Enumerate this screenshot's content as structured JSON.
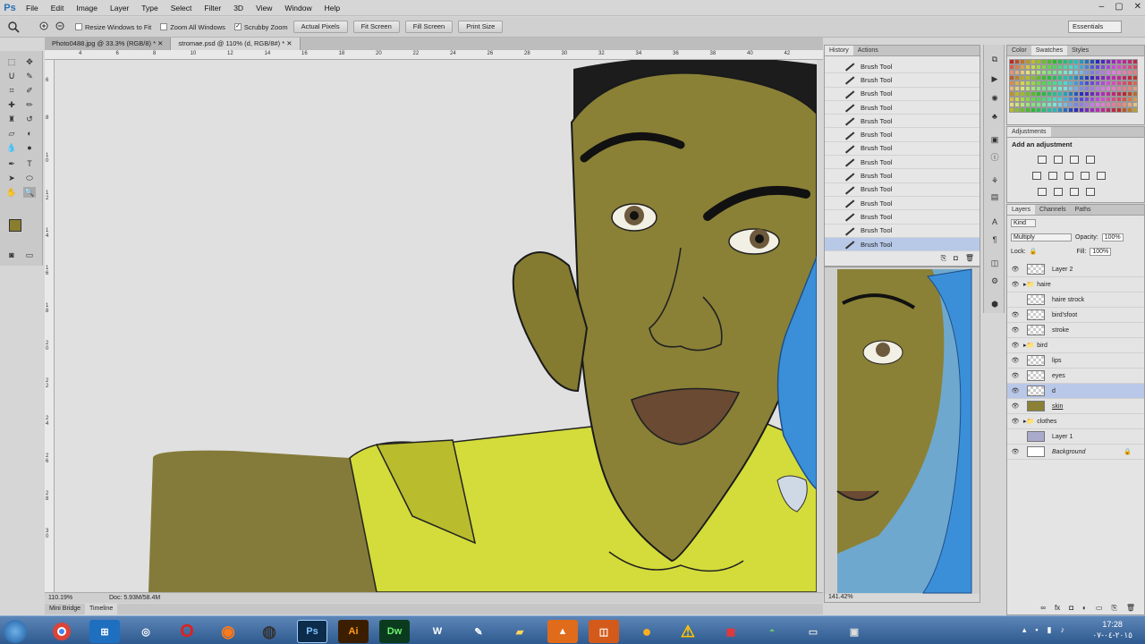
{
  "app": {
    "logo": "Ps",
    "menu": [
      "File",
      "Edit",
      "Image",
      "Layer",
      "Type",
      "Select",
      "Filter",
      "3D",
      "View",
      "Window",
      "Help"
    ],
    "window_controls": [
      "–",
      "▢",
      "✕"
    ]
  },
  "options_bar": {
    "tool_icon": "zoom-icon",
    "resize_windows_label": "Resize Windows to Fit",
    "zoom_all_label": "Zoom All Windows",
    "scrubby_zoom_label": "Scrubby Zoom",
    "actual_pixels": "Actual Pixels",
    "fit_screen": "Fit Screen",
    "fill_screen": "Fill Screen",
    "print_size": "Print Size",
    "workspace": "Essentials"
  },
  "documents": [
    {
      "label": "Photo0488.jpg @ 33.3% (RGB/8) *",
      "active": false
    },
    {
      "label": "stromae.psd @ 110% (d, RGB/8#) *",
      "active": true
    }
  ],
  "ruler_top": [
    "4",
    "6",
    "8",
    "10",
    "12",
    "14",
    "16",
    "18",
    "20",
    "22",
    "24",
    "26",
    "28",
    "30",
    "32",
    "34",
    "36",
    "38",
    "40",
    "42"
  ],
  "ruler_left": [
    "6",
    "8",
    "1 0",
    "1 2",
    "1 4",
    "1 6",
    "1 8",
    "2 0",
    "2 2",
    "2 4",
    "2 6",
    "2 8",
    "3 0"
  ],
  "status": {
    "zoom": "110.19%",
    "doc": "Doc: 5.93M/58.4M"
  },
  "bottom_tabs": [
    "Mini Bridge",
    "Timeline"
  ],
  "history": {
    "tabs": [
      "History",
      "Actions"
    ],
    "items": [
      "Brush Tool",
      "Brush Tool",
      "Brush Tool",
      "Brush Tool",
      "Brush Tool",
      "Brush Tool",
      "Brush Tool",
      "Brush Tool",
      "Brush Tool",
      "Brush Tool",
      "Brush Tool",
      "Brush Tool",
      "Brush Tool",
      "Brush Tool"
    ],
    "selected_index": 13
  },
  "navigator": {
    "zoom": "141.42%"
  },
  "color_panel": {
    "tabs": [
      "Color",
      "Swatches",
      "Styles"
    ]
  },
  "adjustments": {
    "title": "Adjustments",
    "subtitle": "Add an adjustment"
  },
  "layers": {
    "tabs": [
      "Layers",
      "Channels",
      "Paths"
    ],
    "kind": "Kind",
    "blend_mode": "Multiply",
    "opacity_label": "Opacity:",
    "opacity": "100%",
    "lock_label": "Lock:",
    "fill_label": "Fill:",
    "fill": "100%",
    "items": [
      {
        "name": "Layer 2",
        "folder": false,
        "visible": true,
        "selected": false
      },
      {
        "name": "haire",
        "folder": true,
        "visible": true,
        "selected": false
      },
      {
        "name": "haire strock",
        "folder": false,
        "visible": false,
        "selected": false
      },
      {
        "name": "bird'sfoot",
        "folder": false,
        "visible": true,
        "selected": false
      },
      {
        "name": "stroke",
        "folder": false,
        "visible": true,
        "selected": false
      },
      {
        "name": "bird",
        "folder": true,
        "visible": true,
        "selected": false
      },
      {
        "name": "lips",
        "folder": false,
        "visible": true,
        "selected": false
      },
      {
        "name": "eyes",
        "folder": false,
        "visible": true,
        "selected": false
      },
      {
        "name": "d",
        "folder": false,
        "visible": true,
        "selected": true
      },
      {
        "name": "skin",
        "folder": false,
        "visible": true,
        "selected": false
      },
      {
        "name": "clothes",
        "folder": true,
        "visible": true,
        "selected": false
      },
      {
        "name": "Layer 1",
        "folder": false,
        "visible": false,
        "selected": false
      },
      {
        "name": "Background",
        "folder": false,
        "visible": true,
        "selected": false
      }
    ]
  },
  "taskbar": {
    "apps": [
      "start-orb",
      "chrome",
      "explorer",
      "messenger",
      "opera",
      "firefox",
      "cinema4d",
      "Ps",
      "Ai",
      "Dw",
      "word",
      "notepad",
      "folder",
      "vlc",
      "ppt",
      "paint",
      "media",
      "warning",
      "office",
      "network",
      "screen"
    ],
    "time": "17:28",
    "date": "٢٠١٥-٠٤-٠٧"
  },
  "colors": {
    "accent": "#b8c9e8",
    "skin": "#8c8435",
    "shirt": "#d4dc3c",
    "hair": "#1a1a1a",
    "bird": "#3b8fd9"
  }
}
